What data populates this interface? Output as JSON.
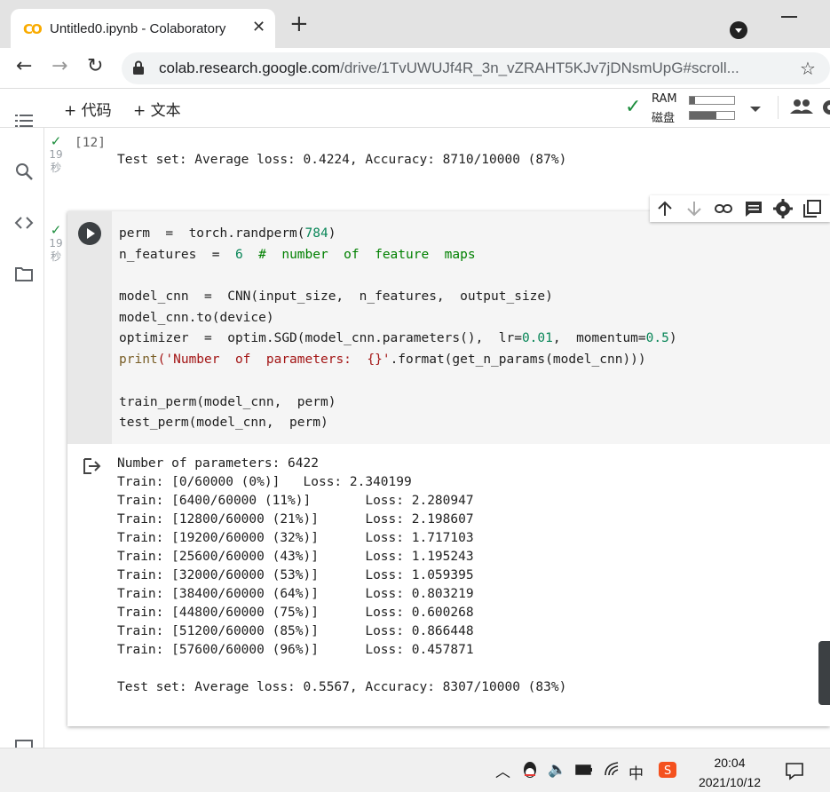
{
  "browser": {
    "tab_title": "Untitled0.ipynb - Colaboratory",
    "logo_text": "CO",
    "close_glyph": "✕",
    "newtab_glyph": "+",
    "url_host": "colab.research.google.com",
    "url_path": "/drive/1TvUWUJf4R_3n_vZRAHT5KJv7jDNsmUpG#scroll...",
    "back_glyph": "←",
    "forward_glyph": "→",
    "reload_glyph": "↻",
    "star_glyph": "☆"
  },
  "colab": {
    "add_code_label": "+ 代码",
    "add_text_label": "+ 文本",
    "ram_label": "RAM",
    "disk_label": "磁盘",
    "ram_usage": 0.12,
    "disk_usage": 0.6,
    "check_glyph": "✓"
  },
  "prev_cell": {
    "exec_count": "[12]",
    "time_value": "19",
    "time_unit": "秒",
    "output": "Test set: Average loss: 0.4224, Accuracy: 8710/10000 (87%)"
  },
  "cell": {
    "time_value": "19",
    "time_unit": "秒",
    "code": [
      [
        {
          "t": "perm  =  torch.randperm(",
          "c": ""
        },
        {
          "t": "784",
          "c": "num"
        },
        {
          "t": ")",
          "c": ""
        }
      ],
      [
        {
          "t": "n_features  =  ",
          "c": ""
        },
        {
          "t": "6",
          "c": "num"
        },
        {
          "t": "  #  number  of  feature  maps",
          "c": "cmt"
        }
      ],
      [
        {
          "t": "",
          "c": ""
        }
      ],
      [
        {
          "t": "model_cnn  =  CNN(input_size,  n_features,  output_size)",
          "c": ""
        }
      ],
      [
        {
          "t": "model_cnn.to(device)",
          "c": ""
        }
      ],
      [
        {
          "t": "optimizer  =  optim.SGD(model_cnn.parameters(),  lr=",
          "c": ""
        },
        {
          "t": "0.01",
          "c": "num"
        },
        {
          "t": ",  momentum=",
          "c": ""
        },
        {
          "t": "0.5",
          "c": "num"
        },
        {
          "t": ")",
          "c": ""
        }
      ],
      [
        {
          "t": "print",
          "c": "kw"
        },
        {
          "t": "('Number  of  parameters:  {}'",
          "c": "str"
        },
        {
          "t": ".format(get_n_params(model_cnn)))",
          "c": ""
        }
      ],
      [
        {
          "t": "",
          "c": ""
        }
      ],
      [
        {
          "t": "train_perm(model_cnn,  perm)",
          "c": ""
        }
      ],
      [
        {
          "t": "test_perm(model_cnn,  perm)",
          "c": ""
        }
      ]
    ],
    "output": [
      "Number of parameters: 6422",
      "Train: [0/60000 (0%)]   Loss: 2.340199",
      "Train: [6400/60000 (11%)]       Loss: 2.280947",
      "Train: [12800/60000 (21%)]      Loss: 2.198607",
      "Train: [19200/60000 (32%)]      Loss: 1.717103",
      "Train: [25600/60000 (43%)]      Loss: 1.195243",
      "Train: [32000/60000 (53%)]      Loss: 1.059395",
      "Train: [38400/60000 (64%)]      Loss: 0.803219",
      "Train: [44800/60000 (75%)]      Loss: 0.600268",
      "Train: [51200/60000 (85%)]      Loss: 0.866448",
      "Train: [57600/60000 (96%)]      Loss: 0.457871",
      "",
      "Test set: Average loss: 0.5567, Accuracy: 8307/10000 (83%)"
    ]
  },
  "taskbar": {
    "time": "20:04",
    "date": "2021/10/12",
    "ime_label": "中",
    "chevron_glyph": "︿",
    "volume_glyph": "🔈"
  },
  "icons": [
    "colab-logo-icon",
    "close-icon",
    "plus-icon",
    "profile-icon",
    "back-icon",
    "forward-icon",
    "reload-icon",
    "lock-icon",
    "star-icon",
    "toc-icon",
    "search-icon",
    "code-icon",
    "folder-icon",
    "run-icon",
    "arrow-up-icon",
    "arrow-down-icon",
    "link-icon",
    "comment-icon",
    "gear-icon",
    "mirror-icon",
    "output-icon",
    "people-icon"
  ],
  "colors": {
    "accent_green": "#1e8e3e",
    "colab_orange": "#f9ab00"
  }
}
